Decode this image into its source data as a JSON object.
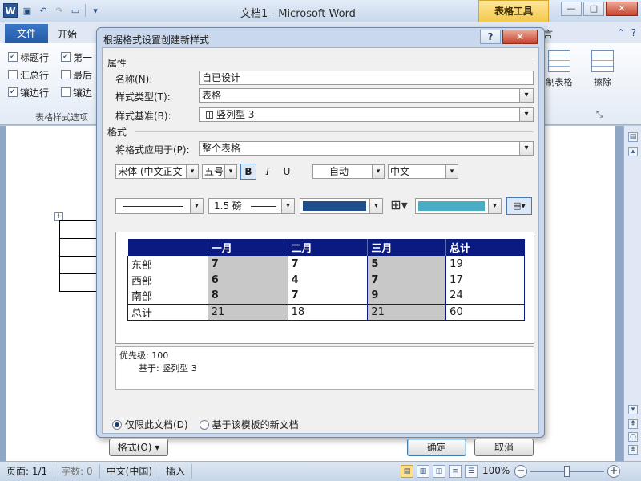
{
  "titlebar": {
    "title": "文档1 - Microsoft Word",
    "contextual_tab": "表格工具",
    "win_minimize": "—",
    "win_restore": "□",
    "win_close": "✕"
  },
  "tabs": {
    "file": "文件",
    "home": "开始",
    "design_suffix": "言"
  },
  "ribbon": {
    "style_options": [
      [
        {
          "label": "标题行",
          "checked": true
        },
        {
          "label": "第一",
          "checked": true
        }
      ],
      [
        {
          "label": "汇总行",
          "checked": false
        },
        {
          "label": "最后",
          "checked": false
        }
      ],
      [
        {
          "label": "镶边行",
          "checked": true
        },
        {
          "label": "镶边",
          "checked": false
        }
      ]
    ],
    "style_group_label": "表格样式选项",
    "draw_table": "制表格",
    "eraser": "擦除"
  },
  "dialog": {
    "title": "根据格式设置创建新样式",
    "help": "?",
    "close": "✕",
    "properties_head": "属性",
    "name_label": "名称(N):",
    "name_value": "自已设计",
    "type_label": "样式类型(T):",
    "type_value": "表格",
    "based_label": "样式基准(B):",
    "based_value": "竖列型 3",
    "format_head": "格式",
    "apply_label": "将格式应用于(P):",
    "apply_value": "整个表格",
    "font": "宋体 (中文正文",
    "size": "五号",
    "bold": "B",
    "italic": "I",
    "underline": "U",
    "color_auto": "自动",
    "script": "中文",
    "weight": "1.5 磅",
    "border_color": "#1f4e8c",
    "shade_color": "#4bacc6",
    "preview": {
      "headers": [
        "",
        "一月",
        "二月",
        "三月",
        "总计"
      ],
      "rows": [
        [
          "东部",
          "7",
          "7",
          "5",
          "19"
        ],
        [
          "西部",
          "6",
          "4",
          "7",
          "17"
        ],
        [
          "南部",
          "8",
          "7",
          "9",
          "24"
        ]
      ],
      "total": [
        "总计",
        "21",
        "18",
        "21",
        "60"
      ]
    },
    "desc_line1": "优先级: 100",
    "desc_line2": "基于: 竖列型 3",
    "radio_doc": "仅限此文档(D)",
    "radio_template": "基于该模板的新文档",
    "format_btn": "格式(O) ▾",
    "ok": "确定",
    "cancel": "取消"
  },
  "statusbar": {
    "page": "页面: 1/1",
    "words": "字数: 0",
    "lang": "中文(中国)",
    "insert": "插入",
    "zoom": "100%",
    "zoom_level_percent": 100
  }
}
